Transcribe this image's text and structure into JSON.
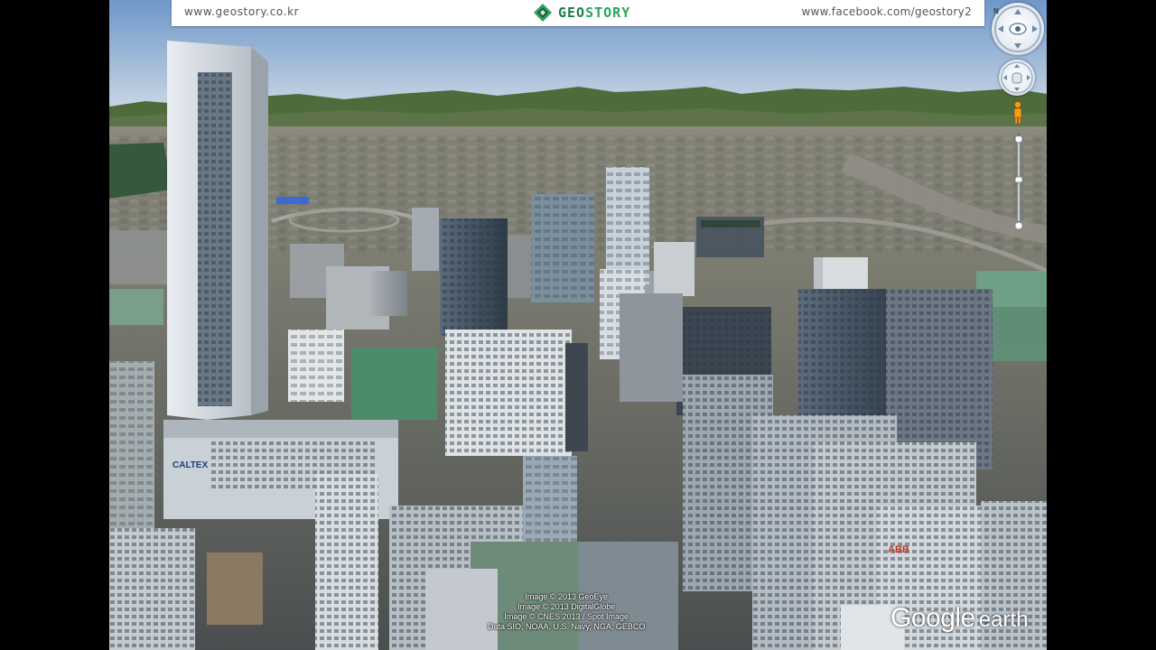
{
  "header": {
    "left_url": "www.geostory.co.kr",
    "logo_text_a": "GEO",
    "logo_text_b": "STORY",
    "right_url": "www.facebook.com/geostory2"
  },
  "navigation": {
    "north_label": "N",
    "zoom_in": "+",
    "zoom_out": "−"
  },
  "credits": {
    "line1": "Image © 2013 GeoEye",
    "line2": "Image © 2013 DigitalGlobe",
    "line3": "Image © CNES 2013 / Spot Image",
    "line4": "Data SIO, NOAA, U.S. Navy, NGA, GEBCO"
  },
  "branding": {
    "google": "Google",
    "earth": "earth"
  },
  "building_signs": {
    "cal_tex": "CALTEX",
    "red_sign": "ABB"
  },
  "colors": {
    "sky": "#9fb9d6",
    "mountains": "#4f6b3c",
    "ground": "#7d7f72",
    "logo_green": "#2aa45c"
  }
}
